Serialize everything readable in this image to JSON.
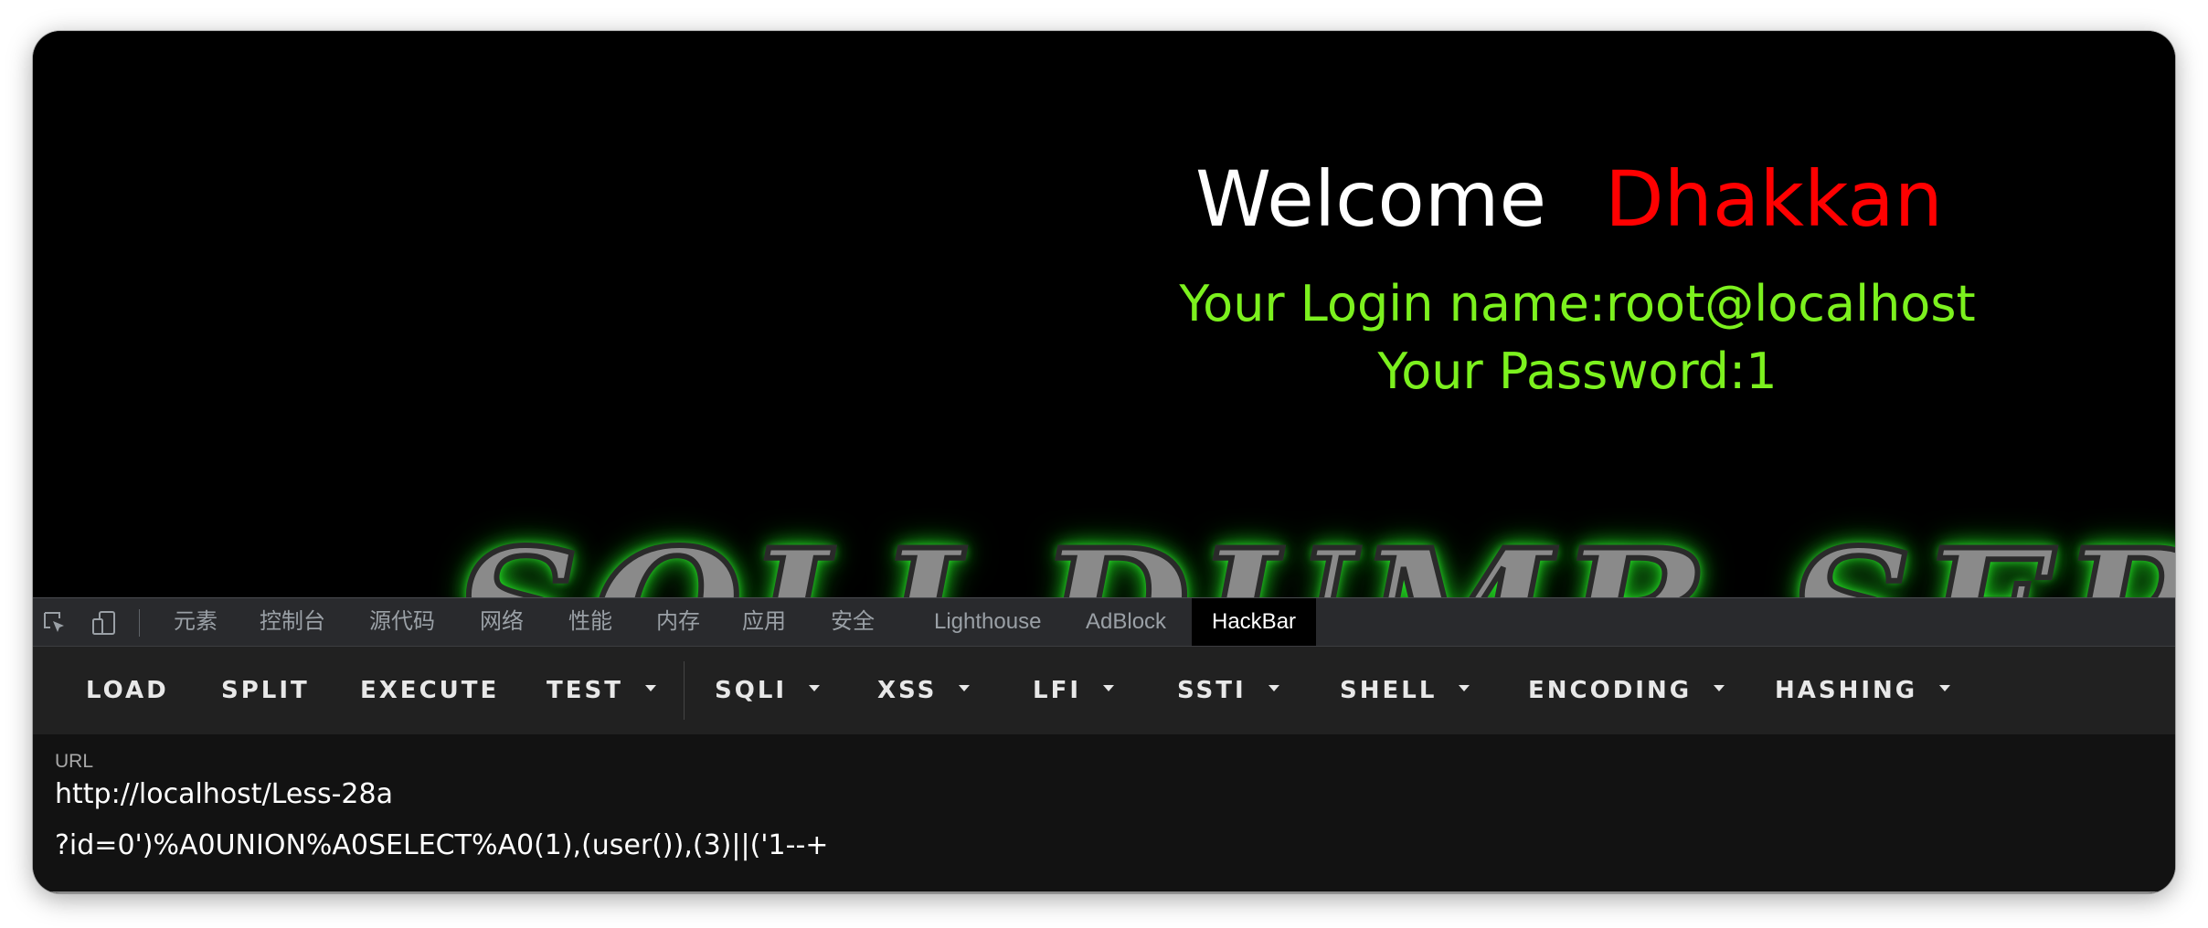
{
  "page": {
    "welcome_word": "Welcome",
    "welcome_name": "Dhakkan",
    "login_name_line": "Your Login name:root@localhost",
    "password_line": "Your Password:1",
    "banner_text": "SQLI DUMB SERIES",
    "colors": {
      "background": "#000000",
      "welcome": "#ffffff",
      "name": "#ff0000",
      "info": "#7cf11e",
      "banner_glow": "#35ff35"
    }
  },
  "devtools": {
    "tools": [
      {
        "icon": "inspect-element-icon"
      },
      {
        "icon": "device-toolbar-icon"
      }
    ],
    "tabs": [
      {
        "label": "元素"
      },
      {
        "label": "控制台"
      },
      {
        "label": "源代码"
      },
      {
        "label": "网络"
      },
      {
        "label": "性能"
      },
      {
        "label": "内存"
      },
      {
        "label": "应用"
      },
      {
        "label": "安全"
      },
      {
        "label": "Lighthouse"
      },
      {
        "label": "AdBlock"
      },
      {
        "label": "HackBar",
        "active": true
      }
    ]
  },
  "hackbar": {
    "buttons": [
      {
        "label": "LOAD"
      },
      {
        "label": "SPLIT"
      },
      {
        "label": "EXECUTE"
      },
      {
        "label": "TEST",
        "dropdown": true
      },
      {
        "label": "SQLI",
        "dropdown": true
      },
      {
        "label": "XSS",
        "dropdown": true
      },
      {
        "label": "LFI",
        "dropdown": true
      },
      {
        "label": "SSTI",
        "dropdown": true
      },
      {
        "label": "SHELL",
        "dropdown": true
      },
      {
        "label": "ENCODING",
        "dropdown": true
      },
      {
        "label": "HASHING",
        "dropdown": true
      }
    ],
    "url_label": "URL",
    "url_line1": "http://localhost/Less-28a",
    "url_line2": "?id=0')%A0UNION%A0SELECT%A0(1),(user()),(3)||('1--+"
  }
}
